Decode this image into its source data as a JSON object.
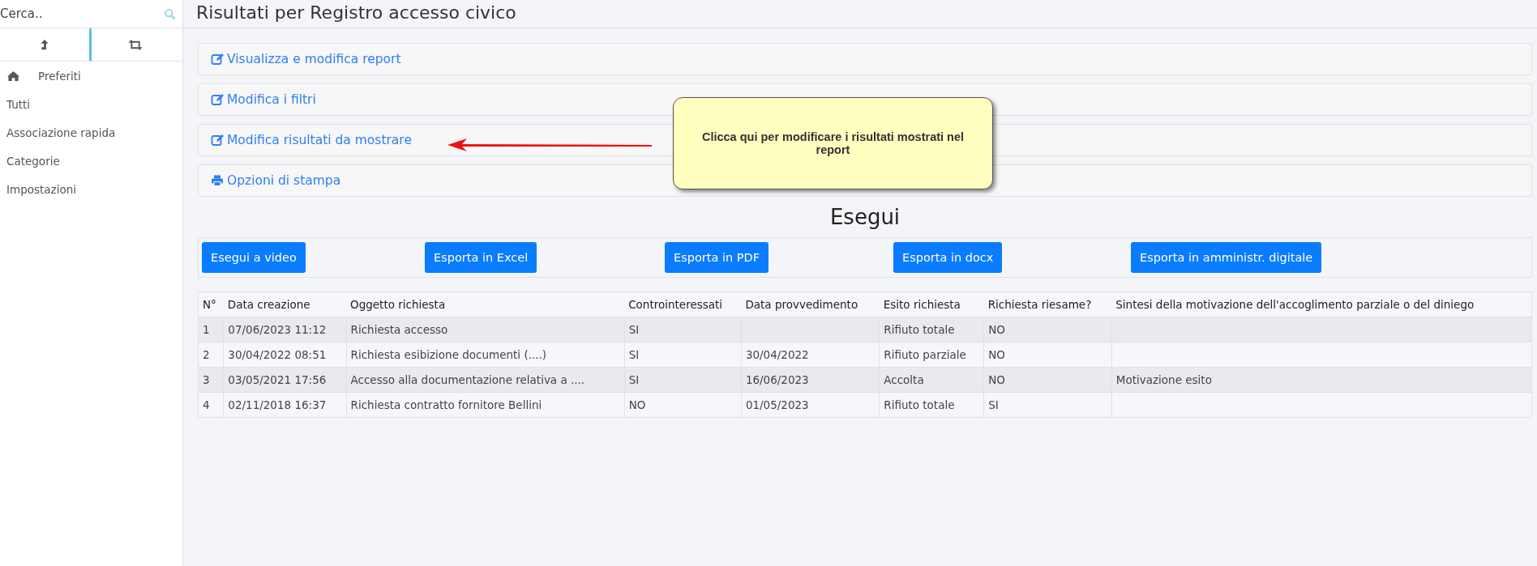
{
  "sidebar": {
    "search": {
      "placeholder": "Cerca.."
    },
    "tabs": [
      {
        "kind": "up",
        "selected": true
      },
      {
        "kind": "repeat",
        "selected": false
      }
    ],
    "items": [
      {
        "label": "Preferiti",
        "kind": "home"
      },
      {
        "label": "Tutti",
        "kind": "plain"
      },
      {
        "label": "Associazione rapida",
        "kind": "plain"
      },
      {
        "label": "Categorie",
        "kind": "plain"
      },
      {
        "label": "Impostazioni",
        "kind": "plain"
      }
    ]
  },
  "title": "Risultati per Registro accesso civico",
  "panels": [
    {
      "label": "Visualizza e modifica report",
      "kind": "edit"
    },
    {
      "label": "Modifica i filtri",
      "kind": "edit"
    },
    {
      "label": "Modifica risultati da mostrare",
      "kind": "edit"
    },
    {
      "label": "Opzioni di stampa",
      "kind": "print"
    }
  ],
  "tooltip": {
    "text": "Clicca qui per modificare i risultati mostrati nel report"
  },
  "run_heading": "Esegui",
  "buttons": [
    "Esegui a video",
    "Esporta in Excel",
    "Esporta in PDF",
    "Esporta in docx",
    "Esporta in amministr. digitale"
  ],
  "table": {
    "columns": [
      "N°",
      "Data creazione",
      "Oggetto richiesta",
      "Controinteressati",
      "Data provvedimento",
      "Esito richiesta",
      "Richiesta riesame?",
      "Sintesi della motivazione dell'accoglimento parziale o del diniego"
    ],
    "rows": [
      [
        "1",
        "07/06/2023 11:12",
        "Richiesta accesso",
        "SI",
        "",
        "Rifiuto totale",
        "NO",
        ""
      ],
      [
        "2",
        "30/04/2022 08:51",
        "Richiesta esibizione documenti (....)",
        "SI",
        "30/04/2022",
        "Rifiuto parziale",
        "NO",
        ""
      ],
      [
        "3",
        "03/05/2021 17:56",
        "Accesso alla documentazione relativa a ....",
        "SI",
        "16/06/2023",
        "Accolta",
        "NO",
        "Motivazione esito"
      ],
      [
        "4",
        "02/11/2018 16:37",
        "Richiesta contratto fornitore Bellini",
        "NO",
        "01/05/2023",
        "Rifiuto totale",
        "SI",
        ""
      ]
    ]
  }
}
